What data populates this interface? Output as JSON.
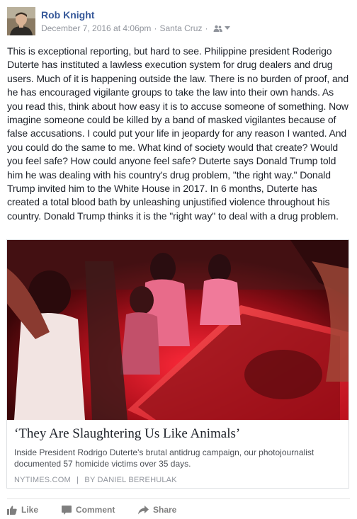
{
  "post": {
    "author": "Rob Knight",
    "date": "December 7, 2016 at 4:06pm",
    "location": "Santa Cruz",
    "separator": "·",
    "audience_icon": "friends-icon",
    "text": "This is exceptional reporting, but hard to see. Philippine president Roderigo Duterte has instituted a lawless execution system for drug dealers and drug users. Much of it is happening outside the law. There is no burden of proof, and he has encouraged vigilante groups to take the law into their own hands. As you read this, think about how easy it is to accuse someone of something. Now imagine someone could be killed by a band of masked vigilantes because of false accusations. I could put your life in jeopardy for any reason I wanted. And you could do the same to me. What kind of society would that create? Would you feel safe? How could anyone feel safe? Duterte says Donald Trump told him he was dealing with his country's drug problem, \"the right way.\" Donald Trump invited him to the White House in 2017. In 6 months, Duterte has created a total blood bath by unleashing unjustified violence throughout his country. Donald Trump thinks it is the \"right way\" to deal with a drug problem."
  },
  "link": {
    "title": "‘They Are Slaughtering Us Like Animals’",
    "description": "Inside President Rodrigo Duterte's brutal antidrug campaign, our photojournalist documented 57 homicide victims over 35 days.",
    "source": "NYTIMES.COM",
    "separator": "|",
    "byline": "BY DANIEL BEREHULAK"
  },
  "actions": {
    "like": "Like",
    "comment": "Comment",
    "share": "Share"
  },
  "colors": {
    "name_link": "#365899",
    "meta": "#90949c",
    "text": "#1d2129",
    "action": "#7f7f7f"
  }
}
